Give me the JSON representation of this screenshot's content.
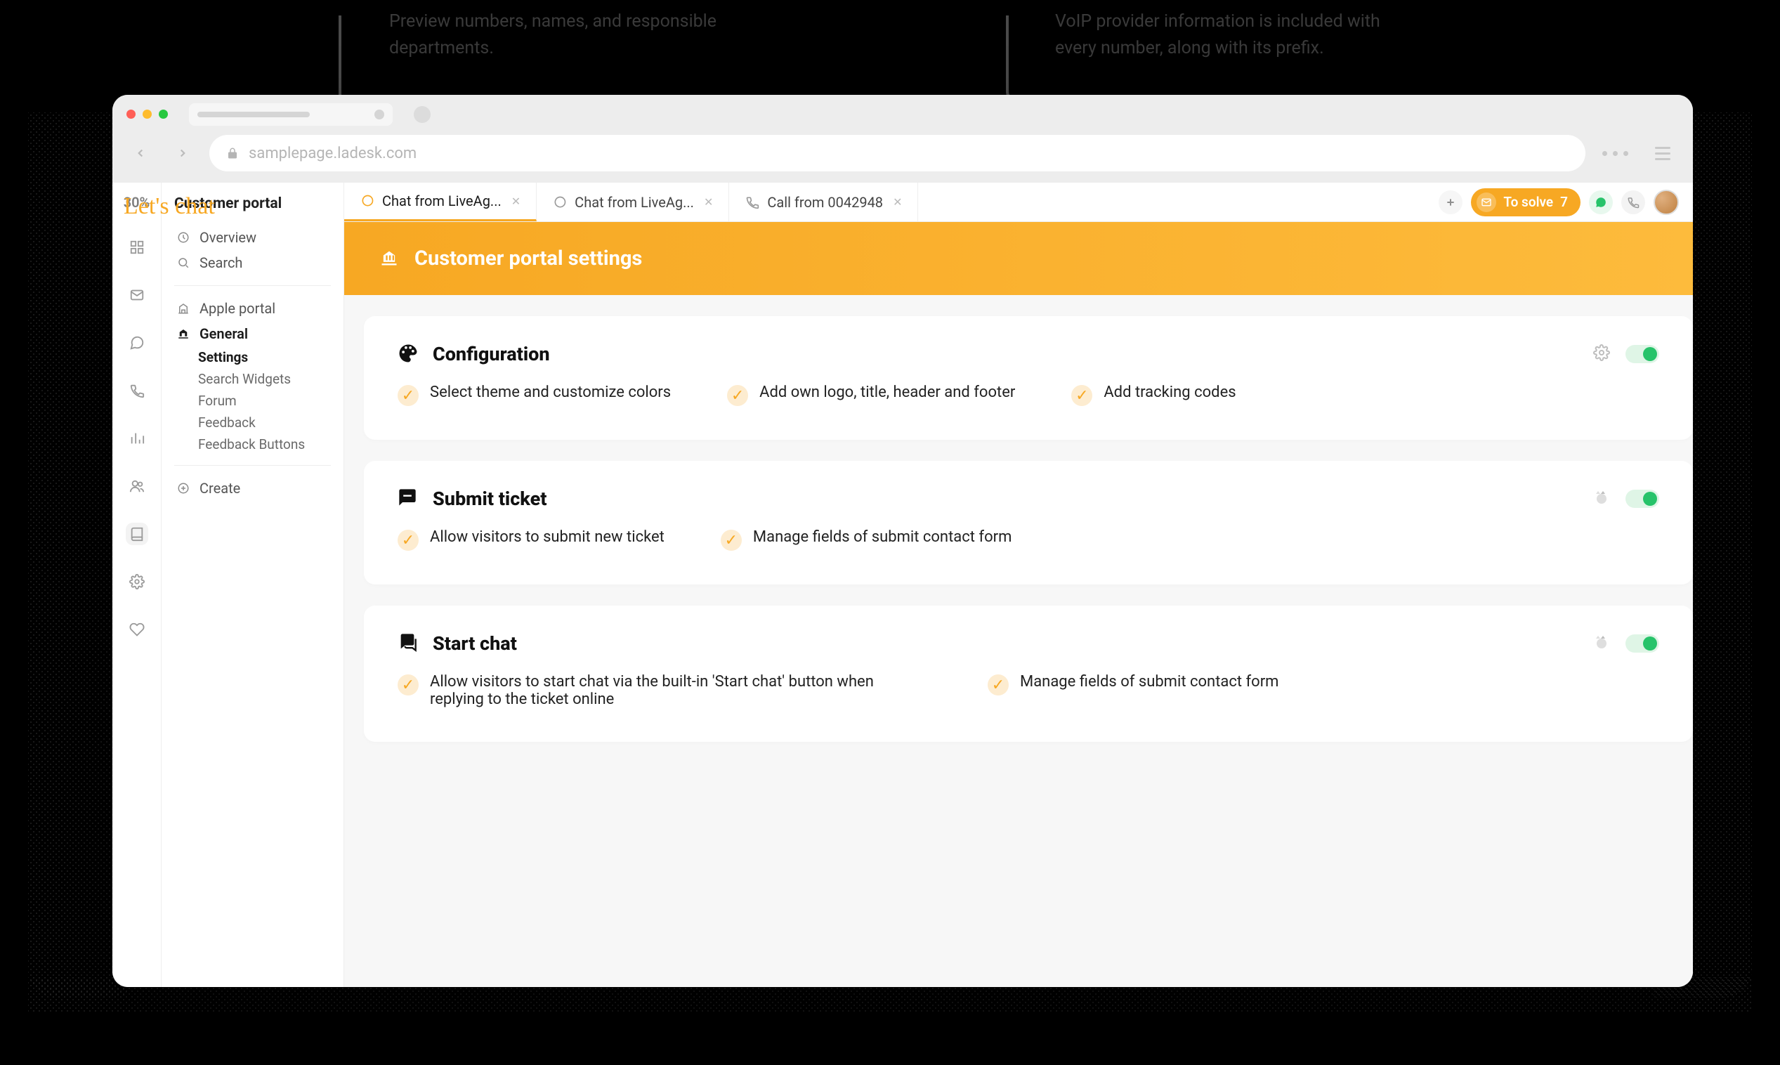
{
  "annotations": {
    "left": "Preview numbers, names, and responsible departments.",
    "right": "VoIP provider information is included with every number, along with its prefix."
  },
  "browser": {
    "url": "samplepage.ladesk.com"
  },
  "logo": "Let's chat",
  "miniSidebar": {
    "percent": "30%"
  },
  "leftPanel": {
    "title": "Customer portal",
    "overview": "Overview",
    "search": "Search",
    "portals": {
      "apple": "Apple portal",
      "general": "General"
    },
    "sub": {
      "settings": "Settings",
      "searchWidgets": "Search Widgets",
      "forum": "Forum",
      "feedback": "Feedback",
      "feedbackButtons": "Feedback Buttons"
    },
    "create": "Create"
  },
  "tabs": [
    {
      "label": "Chat from LiveAg...",
      "icon": "chat",
      "active": true
    },
    {
      "label": "Chat from LiveAg...",
      "icon": "chatg",
      "active": false
    },
    {
      "label": "Call from 0042948",
      "icon": "phone",
      "active": false
    }
  ],
  "topRight": {
    "toSolveLabel": "To solve",
    "toSolveCount": "7"
  },
  "banner": {
    "title": "Customer portal settings"
  },
  "cards": [
    {
      "icon": "palette",
      "title": "Configuration",
      "action": "gear",
      "bullets": [
        "Select theme and customize colors",
        "Add own logo, title, header and footer",
        "Add tracking codes"
      ]
    },
    {
      "icon": "message",
      "title": "Submit ticket",
      "action": "style",
      "bullets": [
        "Allow visitors to submit new ticket",
        "Manage fields of submit contact form"
      ]
    },
    {
      "icon": "chat",
      "title": "Start chat",
      "action": "style",
      "bullets": [
        "Allow visitors to start chat via the built-in 'Start chat' button when replying to the ticket online",
        "Manage fields of submit contact form"
      ]
    }
  ]
}
